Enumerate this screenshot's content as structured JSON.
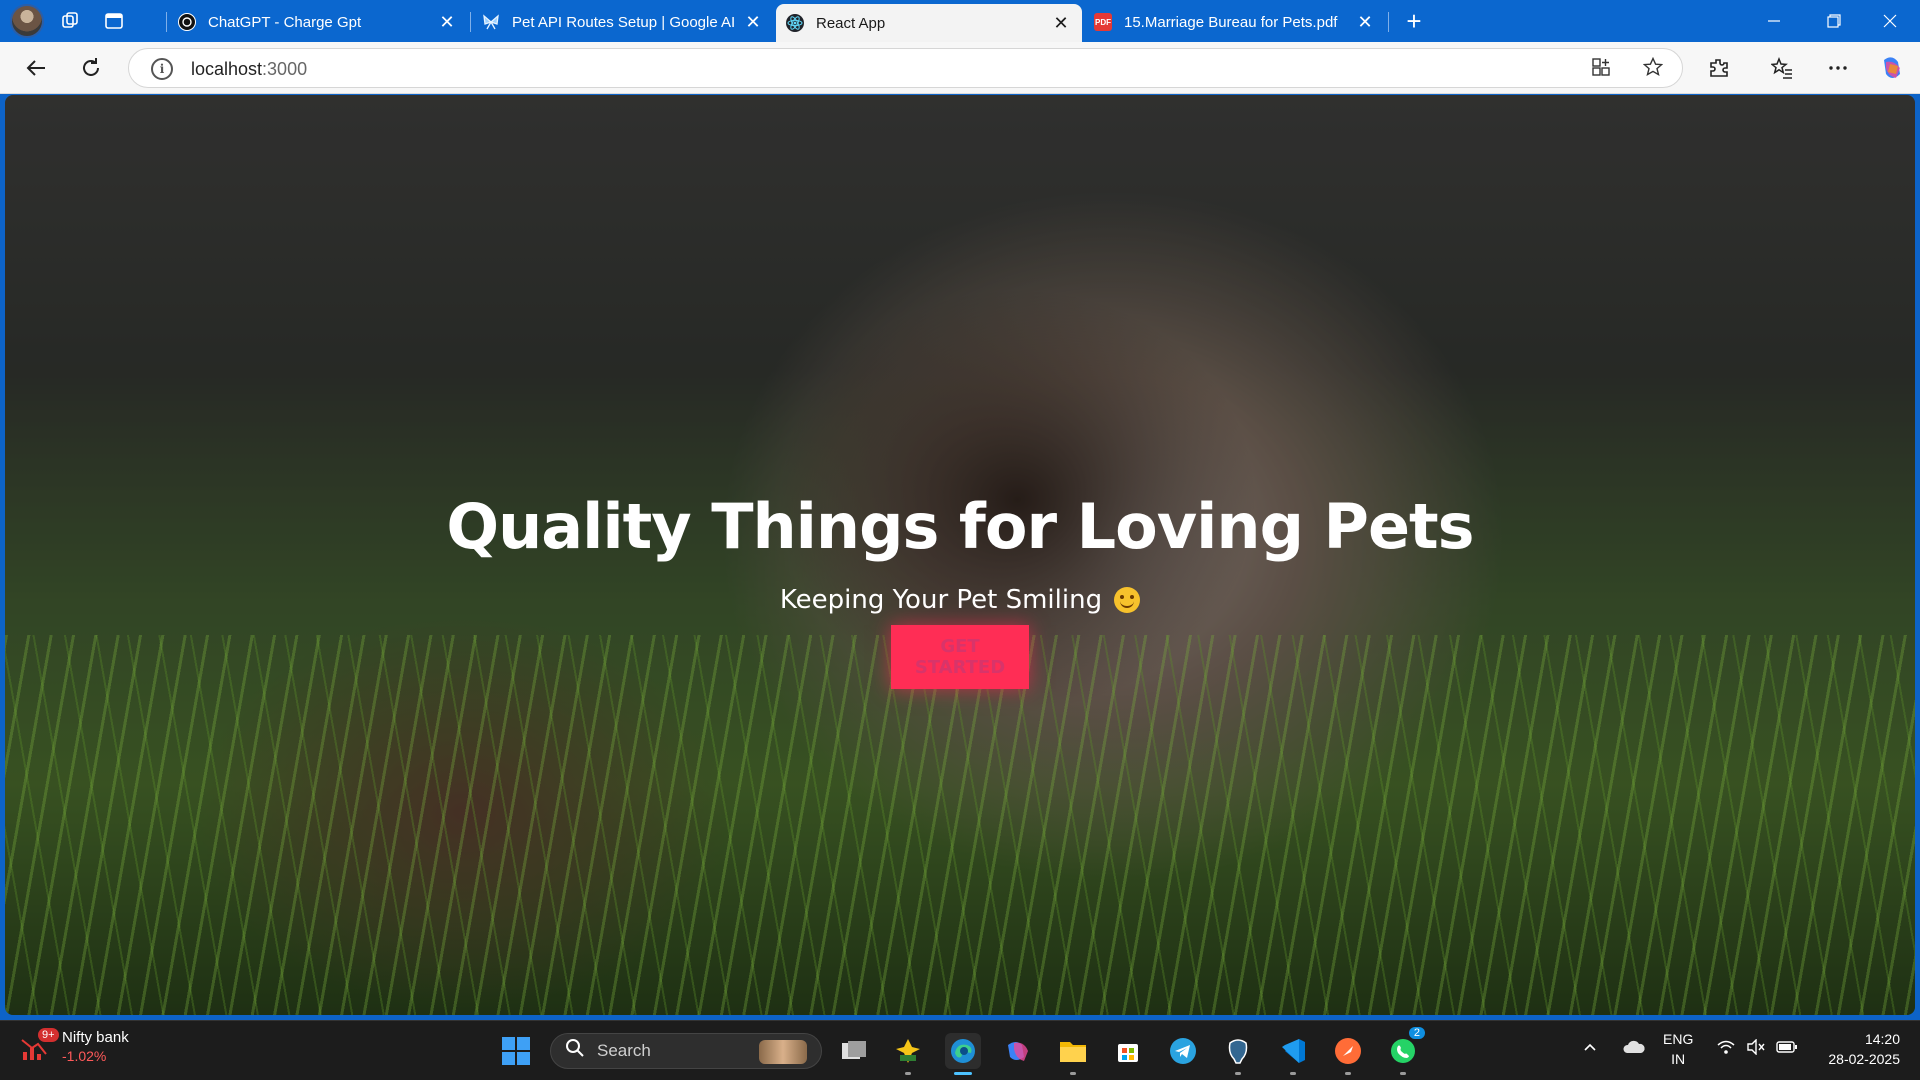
{
  "browser": {
    "tabs": [
      {
        "title": "ChatGPT - Charge Gpt",
        "favicon": "chatgpt-icon",
        "active": false
      },
      {
        "title": "Pet API Routes Setup | Google AI",
        "favicon": "google-ai-icon",
        "active": false
      },
      {
        "title": "React App",
        "favicon": "react-icon",
        "active": true
      },
      {
        "title": "15.Marriage Bureau for Pets.pdf",
        "favicon": "pdf-icon",
        "active": false
      }
    ],
    "address": {
      "host": "localhost",
      "port": ":3000"
    },
    "accent": "#0b67cf"
  },
  "page": {
    "headline": "Quality Things for Loving Pets",
    "subtitle": "Keeping Your Pet Smiling",
    "cta_label": "GET STARTED",
    "cta_color": "#ff2d55",
    "background": "puppy-in-grass-photo"
  },
  "taskbar": {
    "widget": {
      "badge": "9+",
      "name": "Nifty bank",
      "change": "-1.02%"
    },
    "search_placeholder": "Search",
    "apps": [
      "file-explorer-icon",
      "edge-icon",
      "copilot-icon",
      "folder-icon",
      "store-icon",
      "telegram-icon",
      "postgres-icon",
      "vscode-icon",
      "postman-icon",
      "whatsapp-icon"
    ],
    "whatsapp_badge": "2",
    "tray": {
      "lang_top": "ENG",
      "lang_bottom": "IN",
      "time": "14:20",
      "date": "28-02-2025"
    }
  }
}
